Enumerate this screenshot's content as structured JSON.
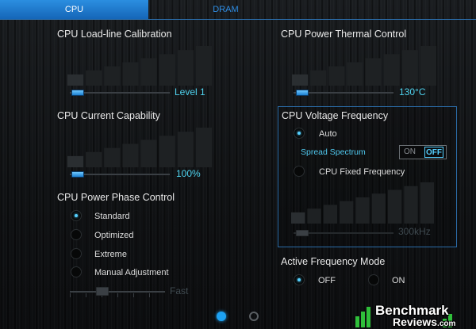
{
  "tabs": [
    {
      "label": "CPU",
      "active": true
    },
    {
      "label": "DRAM",
      "active": false
    }
  ],
  "loadline": {
    "title": "CPU Load-line Calibration",
    "value": "Level 1",
    "bars": 8
  },
  "current": {
    "title": "CPU Current Capability",
    "value": "100%",
    "bars": 8
  },
  "phase": {
    "title": "CPU Power Phase Control",
    "options": [
      "Standard",
      "Optimized",
      "Extreme",
      "Manual Adjustment"
    ],
    "selected": "Standard",
    "slider_label": "Fast"
  },
  "thermal": {
    "title": "CPU Power Thermal Control",
    "value": "130°C",
    "bars": 8
  },
  "voltage_freq": {
    "title": "CPU Voltage Frequency",
    "auto_label": "Auto",
    "spread_label": "Spread Spectrum",
    "toggle_on": "ON",
    "toggle_off": "OFF",
    "fixed_label": "CPU Fixed Frequency",
    "value": "300kHz",
    "selected": "Auto",
    "bars": 9
  },
  "active_freq": {
    "title": "Active Frequency Mode",
    "options": [
      "OFF",
      "ON"
    ],
    "selected": "OFF"
  },
  "pager": {
    "pages": 2,
    "current": 1
  },
  "watermark": {
    "line1": "Benchmark",
    "line2": "Reviews",
    "suffix": ".com"
  },
  "colors": {
    "accent": "#2b8ee0",
    "value_text": "#4fd4f0"
  }
}
